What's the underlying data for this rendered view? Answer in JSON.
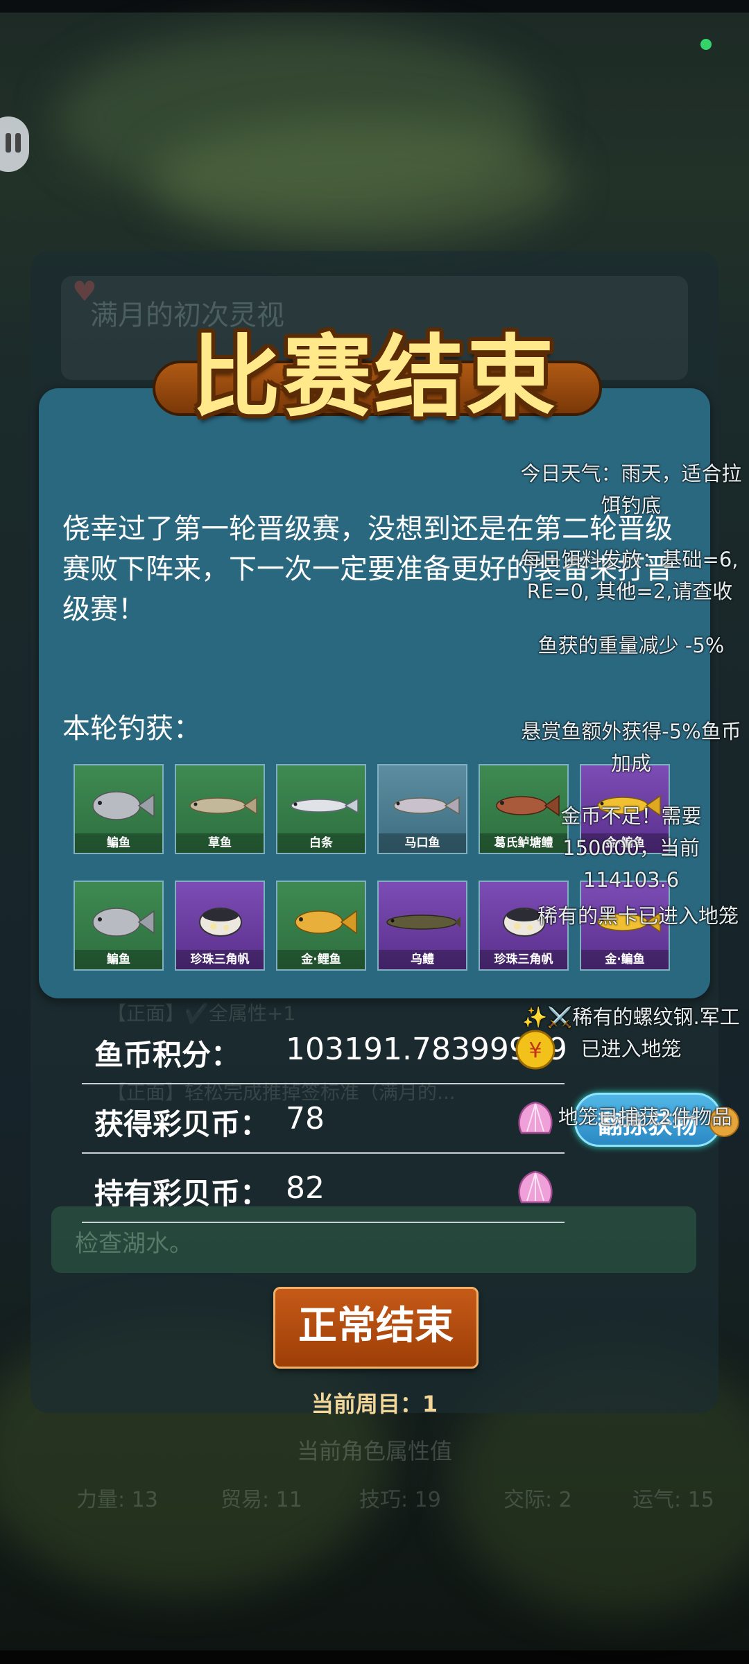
{
  "title": "比赛结束",
  "story": "侥幸过了第一轮晋级赛，没想到还是在第二轮晋级赛败下阵来，下一次一定要准备更好的装备来打晋级赛！",
  "catch_label": "本轮钓获：",
  "background": {
    "player_name": "满月的初次灵视",
    "log_line_1": "【正面】✔️全属性+1",
    "log_line_2": "【正面】轻松完成推掉签标准（满月的...",
    "lake_hint": "检查湖水。"
  },
  "catches_row1": [
    {
      "name": "鳊鱼",
      "rarity": "green",
      "fish": "gray-bream-icon"
    },
    {
      "name": "草鱼",
      "rarity": "green",
      "fish": "grass-carp-icon"
    },
    {
      "name": "白条",
      "rarity": "green",
      "fish": "white-fish-icon"
    },
    {
      "name": "马口鱼",
      "rarity": "teal",
      "fish": "horse-mouth-fish-icon"
    },
    {
      "name": "葛氏鲈塘鳢",
      "rarity": "green",
      "fish": "sleeper-fish-icon"
    },
    {
      "name": "金·鳊鱼",
      "rarity": "purple",
      "fish": "gold-bream-icon"
    }
  ],
  "catches_row2": [
    {
      "name": "鳊鱼",
      "rarity": "green",
      "fish": "gray-bream-icon"
    },
    {
      "name": "珍珠三角帆",
      "rarity": "purple",
      "fish": "pearl-mussel-icon"
    },
    {
      "name": "金·鲤鱼",
      "rarity": "green",
      "fish": "gold-carp-icon"
    },
    {
      "name": "乌鳢",
      "rarity": "purple",
      "fish": "snakehead-icon"
    },
    {
      "name": "珍珠三角帆",
      "rarity": "purple",
      "fish": "pearl-mussel-icon"
    },
    {
      "name": "金·鳊鱼",
      "rarity": "purple",
      "fish": "gold-bream-icon"
    }
  ],
  "notifications": {
    "weather": "今日天气：雨天，适合拉饵钓底",
    "bait": "每日饵料发放：基础=6, RE=0, 其他=2,请查收",
    "weight": "鱼获的重量减少 -5%",
    "bounty": "悬赏鱼额外获得-5%鱼币加成",
    "gold": "金币不足！需要150000，当前 114103.6",
    "black_card": "稀有的黑卡已进入地笼",
    "rebar": "✨⚔️稀有的螺纹钢.军工已进入地笼",
    "cage": "地笼已捕获2件物品"
  },
  "cage_button": "翻拣获物",
  "stats": [
    {
      "label": "鱼币积分：",
      "value": "103191.78399999",
      "icon": "coin-icon"
    },
    {
      "label": "获得彩贝币：",
      "value": "78",
      "icon": "shell-icon"
    },
    {
      "label": "持有彩贝币：",
      "value": "82",
      "icon": "shell-icon"
    }
  ],
  "end_button": "正常结束",
  "round_text": "当前周目：1",
  "attributes_title": "当前角色属性值",
  "attributes": [
    {
      "label": "力量: 13"
    },
    {
      "label": "贸易: 11"
    },
    {
      "label": "技巧: 19"
    },
    {
      "label": "交际: 2"
    },
    {
      "label": "运气: 15"
    }
  ],
  "colors": {
    "panel": "#2a6880",
    "title_fill": "#ffe98a",
    "button": "#b14a0e",
    "card_green": "#3f8a52",
    "card_purple": "#7c4db5",
    "status_dot": "#35d46a"
  }
}
